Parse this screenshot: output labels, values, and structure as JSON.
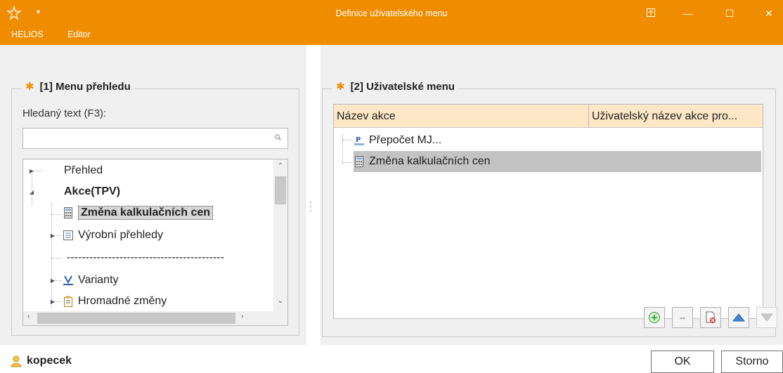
{
  "window": {
    "title": "Definice uživatelského menu",
    "icons": [
      "app-logo-icon",
      "quick-access-arrow-icon",
      "pin-window-icon",
      "minimize-icon",
      "maximize-icon",
      "close-icon"
    ]
  },
  "menubar": [
    "HELIOS",
    "Editor"
  ],
  "left_panel": {
    "title": "[1] Menu přehledu",
    "search_label": "Hledaný text (F3):",
    "search_value": "",
    "tree": [
      {
        "label": "Přehled",
        "bold": false,
        "icon": "none"
      },
      {
        "label": "Akce(TPV)",
        "bold": true,
        "icon": "none"
      },
      {
        "label": "Změna kalkulačních cen",
        "bold": true,
        "selected": true,
        "icon": "calculator-icon"
      },
      {
        "label": "Výrobní přehledy",
        "bold": false,
        "icon": "report-icon"
      },
      {
        "label": "------------------------------------------",
        "bold": false,
        "icon": "none"
      },
      {
        "label": "Varianty",
        "bold": false,
        "icon": "variant-icon"
      },
      {
        "label": "Hromadné změny",
        "bold": false,
        "icon": "clipboard-icon"
      }
    ]
  },
  "right_panel": {
    "title": "[2] Uživatelské menu",
    "columns": [
      "Název akce",
      "Uživatelský název akce pro..."
    ],
    "rows": [
      {
        "label": "Přepočet MJ...",
        "icon": "recalc-icon",
        "selected": false
      },
      {
        "label": "Změna kalkulačních cen",
        "icon": "calculator-icon",
        "selected": true
      }
    ],
    "toolbar_icons": [
      "add-icon",
      "separator-icon",
      "delete-icon",
      "move-up-icon",
      "move-down-icon"
    ]
  },
  "status": {
    "user": "kopecek",
    "ok_label": "OK",
    "cancel_label": "Storno"
  },
  "colors": {
    "accent": "#f08c00",
    "header_bg": "#fde7c6",
    "selection": "#c3c3c3"
  }
}
